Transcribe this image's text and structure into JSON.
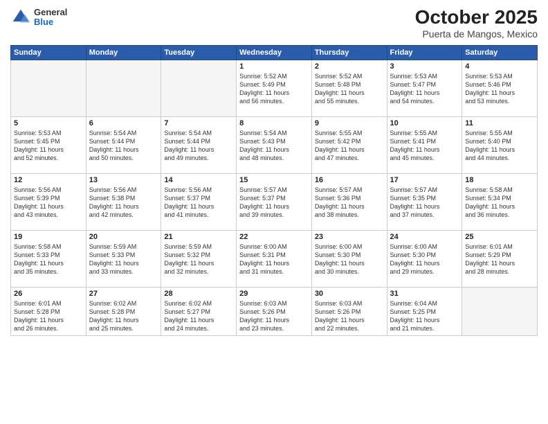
{
  "logo": {
    "general": "General",
    "blue": "Blue"
  },
  "header": {
    "month": "October 2025",
    "location": "Puerta de Mangos, Mexico"
  },
  "weekdays": [
    "Sunday",
    "Monday",
    "Tuesday",
    "Wednesday",
    "Thursday",
    "Friday",
    "Saturday"
  ],
  "weeks": [
    [
      {
        "day": "",
        "info": ""
      },
      {
        "day": "",
        "info": ""
      },
      {
        "day": "",
        "info": ""
      },
      {
        "day": "1",
        "info": "Sunrise: 5:52 AM\nSunset: 5:49 PM\nDaylight: 11 hours\nand 56 minutes."
      },
      {
        "day": "2",
        "info": "Sunrise: 5:52 AM\nSunset: 5:48 PM\nDaylight: 11 hours\nand 55 minutes."
      },
      {
        "day": "3",
        "info": "Sunrise: 5:53 AM\nSunset: 5:47 PM\nDaylight: 11 hours\nand 54 minutes."
      },
      {
        "day": "4",
        "info": "Sunrise: 5:53 AM\nSunset: 5:46 PM\nDaylight: 11 hours\nand 53 minutes."
      }
    ],
    [
      {
        "day": "5",
        "info": "Sunrise: 5:53 AM\nSunset: 5:45 PM\nDaylight: 11 hours\nand 52 minutes."
      },
      {
        "day": "6",
        "info": "Sunrise: 5:54 AM\nSunset: 5:44 PM\nDaylight: 11 hours\nand 50 minutes."
      },
      {
        "day": "7",
        "info": "Sunrise: 5:54 AM\nSunset: 5:44 PM\nDaylight: 11 hours\nand 49 minutes."
      },
      {
        "day": "8",
        "info": "Sunrise: 5:54 AM\nSunset: 5:43 PM\nDaylight: 11 hours\nand 48 minutes."
      },
      {
        "day": "9",
        "info": "Sunrise: 5:55 AM\nSunset: 5:42 PM\nDaylight: 11 hours\nand 47 minutes."
      },
      {
        "day": "10",
        "info": "Sunrise: 5:55 AM\nSunset: 5:41 PM\nDaylight: 11 hours\nand 45 minutes."
      },
      {
        "day": "11",
        "info": "Sunrise: 5:55 AM\nSunset: 5:40 PM\nDaylight: 11 hours\nand 44 minutes."
      }
    ],
    [
      {
        "day": "12",
        "info": "Sunrise: 5:56 AM\nSunset: 5:39 PM\nDaylight: 11 hours\nand 43 minutes."
      },
      {
        "day": "13",
        "info": "Sunrise: 5:56 AM\nSunset: 5:38 PM\nDaylight: 11 hours\nand 42 minutes."
      },
      {
        "day": "14",
        "info": "Sunrise: 5:56 AM\nSunset: 5:37 PM\nDaylight: 11 hours\nand 41 minutes."
      },
      {
        "day": "15",
        "info": "Sunrise: 5:57 AM\nSunset: 5:37 PM\nDaylight: 11 hours\nand 39 minutes."
      },
      {
        "day": "16",
        "info": "Sunrise: 5:57 AM\nSunset: 5:36 PM\nDaylight: 11 hours\nand 38 minutes."
      },
      {
        "day": "17",
        "info": "Sunrise: 5:57 AM\nSunset: 5:35 PM\nDaylight: 11 hours\nand 37 minutes."
      },
      {
        "day": "18",
        "info": "Sunrise: 5:58 AM\nSunset: 5:34 PM\nDaylight: 11 hours\nand 36 minutes."
      }
    ],
    [
      {
        "day": "19",
        "info": "Sunrise: 5:58 AM\nSunset: 5:33 PM\nDaylight: 11 hours\nand 35 minutes."
      },
      {
        "day": "20",
        "info": "Sunrise: 5:59 AM\nSunset: 5:33 PM\nDaylight: 11 hours\nand 33 minutes."
      },
      {
        "day": "21",
        "info": "Sunrise: 5:59 AM\nSunset: 5:32 PM\nDaylight: 11 hours\nand 32 minutes."
      },
      {
        "day": "22",
        "info": "Sunrise: 6:00 AM\nSunset: 5:31 PM\nDaylight: 11 hours\nand 31 minutes."
      },
      {
        "day": "23",
        "info": "Sunrise: 6:00 AM\nSunset: 5:30 PM\nDaylight: 11 hours\nand 30 minutes."
      },
      {
        "day": "24",
        "info": "Sunrise: 6:00 AM\nSunset: 5:30 PM\nDaylight: 11 hours\nand 29 minutes."
      },
      {
        "day": "25",
        "info": "Sunrise: 6:01 AM\nSunset: 5:29 PM\nDaylight: 11 hours\nand 28 minutes."
      }
    ],
    [
      {
        "day": "26",
        "info": "Sunrise: 6:01 AM\nSunset: 5:28 PM\nDaylight: 11 hours\nand 26 minutes."
      },
      {
        "day": "27",
        "info": "Sunrise: 6:02 AM\nSunset: 5:28 PM\nDaylight: 11 hours\nand 25 minutes."
      },
      {
        "day": "28",
        "info": "Sunrise: 6:02 AM\nSunset: 5:27 PM\nDaylight: 11 hours\nand 24 minutes."
      },
      {
        "day": "29",
        "info": "Sunrise: 6:03 AM\nSunset: 5:26 PM\nDaylight: 11 hours\nand 23 minutes."
      },
      {
        "day": "30",
        "info": "Sunrise: 6:03 AM\nSunset: 5:26 PM\nDaylight: 11 hours\nand 22 minutes."
      },
      {
        "day": "31",
        "info": "Sunrise: 6:04 AM\nSunset: 5:25 PM\nDaylight: 11 hours\nand 21 minutes."
      },
      {
        "day": "",
        "info": ""
      }
    ]
  ]
}
